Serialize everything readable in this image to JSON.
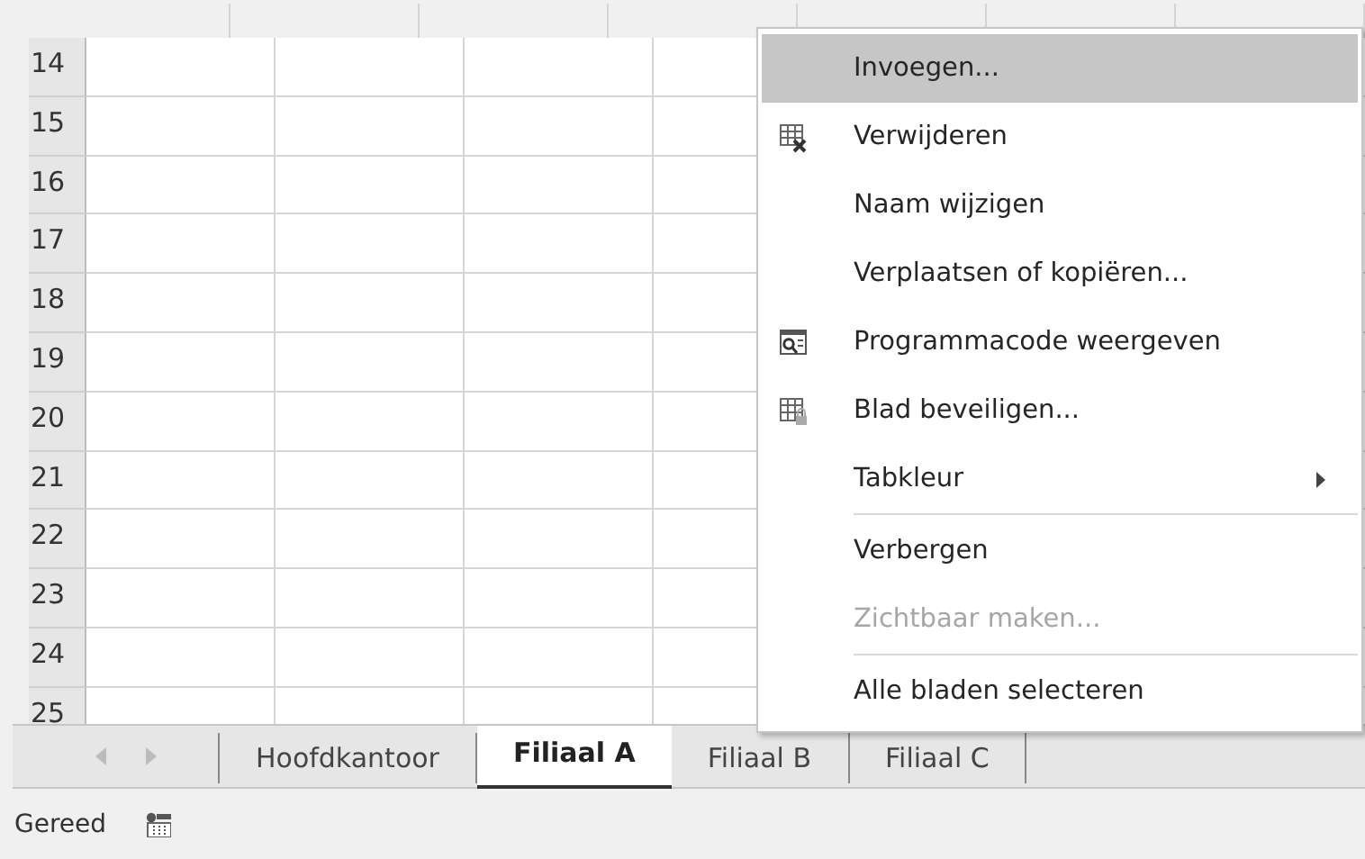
{
  "sheet": {
    "row_numbers": [
      "14",
      "15",
      "16",
      "17",
      "18",
      "19",
      "20",
      "21",
      "22",
      "23",
      "24",
      "25"
    ]
  },
  "sheet_tabs": [
    {
      "label": "Hoofdkantoor",
      "selected": false
    },
    {
      "label": "Filiaal A",
      "selected": true
    },
    {
      "label": "Filiaal B",
      "selected": false
    },
    {
      "label": "Filiaal C",
      "selected": false
    }
  ],
  "context_menu": [
    {
      "label": "Invoegen...",
      "selected": true,
      "disabled": false,
      "icon": false,
      "submenu": false,
      "separator_before": false
    },
    {
      "label": "Verwijderen",
      "selected": false,
      "disabled": false,
      "icon": true,
      "submenu": false,
      "separator_before": false
    },
    {
      "label": "Naam wijzigen",
      "selected": false,
      "disabled": false,
      "icon": false,
      "submenu": false,
      "separator_before": false
    },
    {
      "label": "Verplaatsen of kopiëren...",
      "selected": false,
      "disabled": false,
      "icon": false,
      "submenu": false,
      "separator_before": false
    },
    {
      "label": "Programmacode weergeven",
      "selected": false,
      "disabled": false,
      "icon": true,
      "submenu": false,
      "separator_before": false
    },
    {
      "label": "Blad beveiligen...",
      "selected": false,
      "disabled": false,
      "icon": true,
      "submenu": false,
      "separator_before": false
    },
    {
      "label": "Tabkleur",
      "selected": false,
      "disabled": false,
      "icon": false,
      "submenu": true,
      "separator_before": false
    },
    {
      "label": "Verbergen",
      "selected": false,
      "disabled": false,
      "icon": false,
      "submenu": false,
      "separator_before": true
    },
    {
      "label": "Zichtbaar maken...",
      "selected": false,
      "disabled": true,
      "icon": false,
      "submenu": false,
      "separator_before": false
    },
    {
      "label": "Alle bladen selecteren",
      "selected": false,
      "disabled": false,
      "icon": false,
      "submenu": false,
      "separator_before": true
    }
  ],
  "status_bar": {
    "text": "Gereed"
  }
}
